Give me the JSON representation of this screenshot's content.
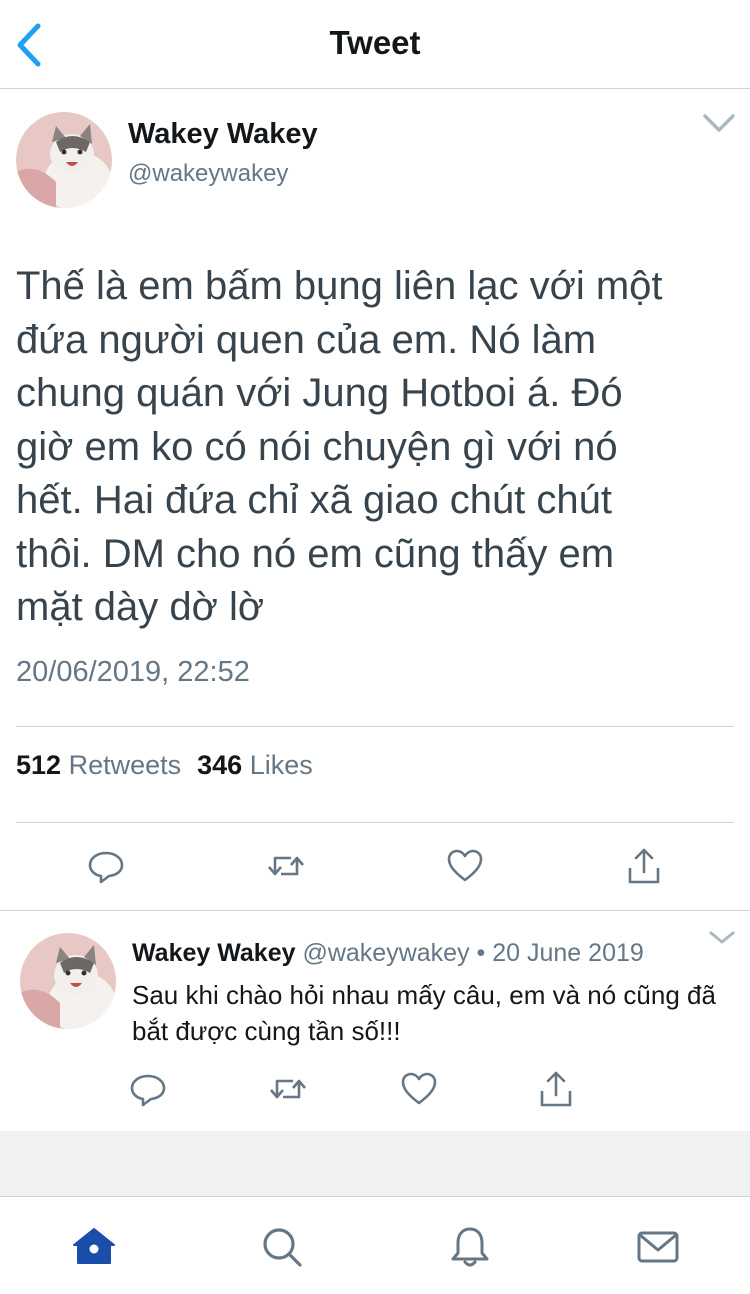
{
  "header": {
    "title": "Tweet"
  },
  "tweet": {
    "author_name": "Wakey Wakey",
    "author_handle": "@wakeywakey",
    "text": "Thế là em bấm bụng liên lạc với một\nđứa người quen của em. Nó làm\nchung quán với Jung Hotboi á. Đó\ngiờ em ko có nói chuyện gì với nó\nhết. Hai đứa chỉ xã giao chút chút\nthôi. DM cho nó em cũng thấy em\nmặt dày dờ lờ",
    "timestamp": "20/06/2019, 22:52",
    "retweets_count": "512",
    "retweets_label": "Retweets",
    "likes_count": "346",
    "likes_label": "Likes"
  },
  "reply": {
    "author_name": "Wakey Wakey",
    "author_handle": "@wakeywakey",
    "separator": "•",
    "date": "20 June 2019",
    "text": "Sau khi chào hỏi nhau mấy câu, em và nó cũng đã bắt được cùng tần số!!!"
  },
  "icons": {
    "back": "chevron-left-icon",
    "more": "chevron-down-icon",
    "reply": "reply-icon",
    "retweet": "retweet-icon",
    "like": "heart-icon",
    "share": "share-icon",
    "home": "home-icon",
    "search": "search-icon",
    "notifications": "bell-icon",
    "messages": "mail-icon"
  },
  "colors": {
    "accent": "#1da1f2",
    "tab_active": "#1b4eaa",
    "icon_gray": "#657786",
    "text": "#14171a"
  }
}
